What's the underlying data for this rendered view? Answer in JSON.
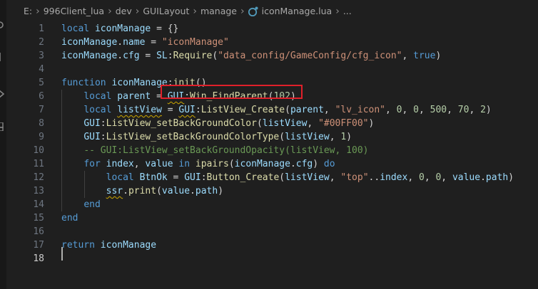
{
  "breadcrumb": {
    "items": [
      "E:",
      "996Client_lua",
      "dev",
      "GUILayout",
      "manage",
      "iconManage.lua"
    ],
    "ellipsis": "..."
  },
  "colors": {
    "background": "#1f1f1f",
    "keyword": "#569cd6",
    "variable": "#9cdcfe",
    "function": "#dcdcaa",
    "string": "#ce9178",
    "number": "#b5cea8",
    "comment": "#6a9955",
    "highlight_box": "#e0202a"
  },
  "editor": {
    "active_line": 18,
    "lines": [
      {
        "num": "1",
        "tokens": [
          [
            "k",
            "local "
          ],
          [
            "v",
            "iconManage"
          ],
          [
            "p",
            " = {}"
          ]
        ]
      },
      {
        "num": "2",
        "tokens": [
          [
            "v",
            "iconManage"
          ],
          [
            "p",
            "."
          ],
          [
            "v",
            "name"
          ],
          [
            "p",
            " = "
          ],
          [
            "s",
            "\"iconManage\""
          ]
        ]
      },
      {
        "num": "3",
        "tokens": [
          [
            "v",
            "iconManage"
          ],
          [
            "p",
            "."
          ],
          [
            "v",
            "cfg"
          ],
          [
            "p",
            " = "
          ],
          [
            "v",
            "SL"
          ],
          [
            "p",
            ":"
          ],
          [
            "f",
            "Require"
          ],
          [
            "p",
            "("
          ],
          [
            "s",
            "\"data_config/GameConfig/cfg_icon\""
          ],
          [
            "p",
            ", "
          ],
          [
            "k",
            "true"
          ],
          [
            "p",
            ")"
          ]
        ]
      },
      {
        "num": "4",
        "tokens": []
      },
      {
        "num": "5",
        "tokens": [
          [
            "k",
            "function "
          ],
          [
            "v",
            "iconManage"
          ],
          [
            "p",
            ":"
          ],
          [
            "f",
            "init"
          ],
          [
            "p",
            "()"
          ]
        ]
      },
      {
        "num": "6",
        "tokens": [
          [
            "p",
            "    "
          ],
          [
            "k",
            "local "
          ],
          [
            "v",
            "parent"
          ],
          [
            "p",
            " = "
          ],
          [
            "vq",
            "GUI"
          ],
          [
            "p",
            ":"
          ],
          [
            "f",
            "Win_FindParent"
          ],
          [
            "p",
            "("
          ],
          [
            "n",
            "102"
          ],
          [
            "p",
            ")"
          ]
        ]
      },
      {
        "num": "7",
        "tokens": [
          [
            "p",
            "    "
          ],
          [
            "k",
            "local "
          ],
          [
            "vq",
            "listView"
          ],
          [
            "p",
            " = "
          ],
          [
            "vq",
            "GUI"
          ],
          [
            "p",
            ":"
          ],
          [
            "f",
            "ListView_Create"
          ],
          [
            "p",
            "("
          ],
          [
            "v",
            "parent"
          ],
          [
            "p",
            ", "
          ],
          [
            "s",
            "\"lv_icon\""
          ],
          [
            "p",
            ", "
          ],
          [
            "n",
            "0"
          ],
          [
            "p",
            ", "
          ],
          [
            "n",
            "0"
          ],
          [
            "p",
            ", "
          ],
          [
            "n",
            "500"
          ],
          [
            "p",
            ", "
          ],
          [
            "n",
            "70"
          ],
          [
            "p",
            ", "
          ],
          [
            "n",
            "2"
          ],
          [
            "p",
            ")"
          ]
        ]
      },
      {
        "num": "8",
        "tokens": [
          [
            "p",
            "    "
          ],
          [
            "v",
            "GUI"
          ],
          [
            "p",
            ":"
          ],
          [
            "f",
            "ListView_setBackGroundColor"
          ],
          [
            "p",
            "("
          ],
          [
            "v",
            "listView"
          ],
          [
            "p",
            ", "
          ],
          [
            "s",
            "\"#00FF00\""
          ],
          [
            "p",
            ")"
          ]
        ]
      },
      {
        "num": "9",
        "tokens": [
          [
            "p",
            "    "
          ],
          [
            "v",
            "GUI"
          ],
          [
            "p",
            ":"
          ],
          [
            "f",
            "ListView_setBackGroundColorType"
          ],
          [
            "p",
            "("
          ],
          [
            "v",
            "listView"
          ],
          [
            "p",
            ", "
          ],
          [
            "n",
            "1"
          ],
          [
            "p",
            ")"
          ]
        ]
      },
      {
        "num": "10",
        "tokens": [
          [
            "p",
            "    "
          ],
          [
            "c",
            "-- GUI:ListView_setBackGroundOpacity(listView, 100)"
          ]
        ]
      },
      {
        "num": "11",
        "tokens": [
          [
            "p",
            "    "
          ],
          [
            "k",
            "for "
          ],
          [
            "v",
            "index"
          ],
          [
            "p",
            ", "
          ],
          [
            "v",
            "value"
          ],
          [
            "k",
            " in "
          ],
          [
            "f",
            "ipairs"
          ],
          [
            "p",
            "("
          ],
          [
            "v",
            "iconManage"
          ],
          [
            "p",
            "."
          ],
          [
            "v",
            "cfg"
          ],
          [
            "p",
            ") "
          ],
          [
            "k",
            "do"
          ]
        ]
      },
      {
        "num": "12",
        "tokens": [
          [
            "p",
            "        "
          ],
          [
            "k",
            "local "
          ],
          [
            "v",
            "BtnOk"
          ],
          [
            "p",
            " = "
          ],
          [
            "v",
            "GUI"
          ],
          [
            "p",
            ":"
          ],
          [
            "f",
            "Button_Create"
          ],
          [
            "p",
            "("
          ],
          [
            "v",
            "listView"
          ],
          [
            "p",
            ", "
          ],
          [
            "s",
            "\"top\""
          ],
          [
            "p",
            ".."
          ],
          [
            "v",
            "index"
          ],
          [
            "p",
            ", "
          ],
          [
            "n",
            "0"
          ],
          [
            "p",
            ", "
          ],
          [
            "n",
            "0"
          ],
          [
            "p",
            ", "
          ],
          [
            "v",
            "value"
          ],
          [
            "p",
            "."
          ],
          [
            "v",
            "path"
          ],
          [
            "p",
            ")"
          ]
        ]
      },
      {
        "num": "13",
        "tokens": [
          [
            "p",
            "        "
          ],
          [
            "vq",
            "ssr"
          ],
          [
            "p",
            "."
          ],
          [
            "f",
            "print"
          ],
          [
            "p",
            "("
          ],
          [
            "v",
            "value"
          ],
          [
            "p",
            "."
          ],
          [
            "v",
            "path"
          ],
          [
            "p",
            ")"
          ]
        ]
      },
      {
        "num": "14",
        "tokens": [
          [
            "p",
            "    "
          ],
          [
            "k",
            "end"
          ]
        ]
      },
      {
        "num": "15",
        "tokens": [
          [
            "k",
            "end"
          ]
        ]
      },
      {
        "num": "16",
        "tokens": []
      },
      {
        "num": "17",
        "tokens": [
          [
            "k",
            "return "
          ],
          [
            "v",
            "iconManage"
          ]
        ]
      },
      {
        "num": "18",
        "tokens": []
      }
    ]
  }
}
